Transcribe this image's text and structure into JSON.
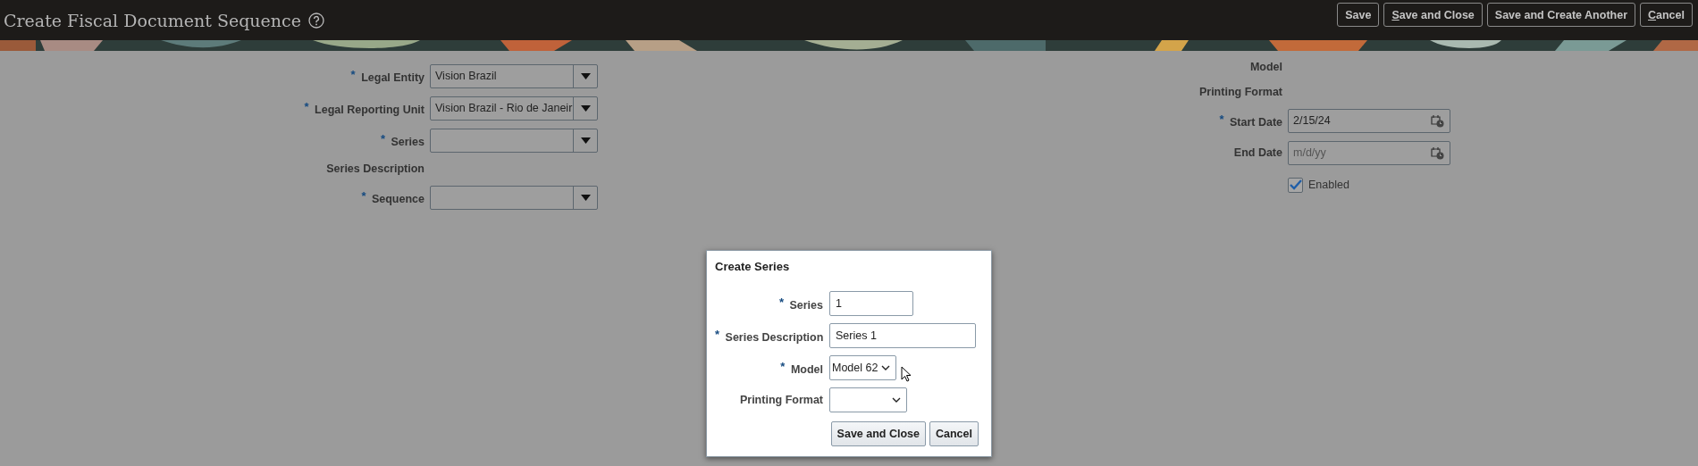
{
  "header": {
    "title": "Create Fiscal Document Sequence",
    "buttons": [
      {
        "label": "Save",
        "underline_first": false
      },
      {
        "label": "Save and Close",
        "underline_first": true
      },
      {
        "label": "Save and Create Another",
        "underline_first": false
      },
      {
        "label": "Cancel",
        "underline_first": true
      }
    ]
  },
  "left_form": [
    {
      "kind": "select",
      "required_mark": "*",
      "label": "Legal Entity",
      "value": "Vision Brazil"
    },
    {
      "kind": "select",
      "required_mark": "*",
      "label": "Legal Reporting Unit",
      "value": "Vision Brazil - Rio de Janeir"
    },
    {
      "kind": "select",
      "required_mark": "*",
      "label": "Series"
    },
    {
      "kind": "readonly",
      "label": "Series Description"
    },
    {
      "kind": "select",
      "required_mark": "*",
      "label": "Sequence"
    }
  ],
  "right_form": [
    {
      "kind": "readonly",
      "label": "Model"
    },
    {
      "kind": "readonly",
      "label": "Printing Format"
    },
    {
      "kind": "date",
      "required_mark": "*",
      "label": "Start Date",
      "value": "2/15/24"
    },
    {
      "kind": "date",
      "label": "End Date",
      "placeholder": "m/d/yy"
    },
    {
      "kind": "checkbox",
      "label": "Enabled",
      "checked": true
    }
  ],
  "dialog": {
    "title": "Create Series",
    "fields": [
      {
        "kind": "code",
        "required_mark": "*",
        "label": "Series",
        "value": "1"
      },
      {
        "kind": "text",
        "required_mark": "*",
        "label": "Series Description",
        "value": "Series 1"
      },
      {
        "kind": "choice",
        "required_mark": "*",
        "label": "Model",
        "value": "Model 62"
      },
      {
        "kind": "choice",
        "label": "Printing Format"
      }
    ],
    "buttons": [
      "Save and Close",
      "Cancel"
    ]
  }
}
